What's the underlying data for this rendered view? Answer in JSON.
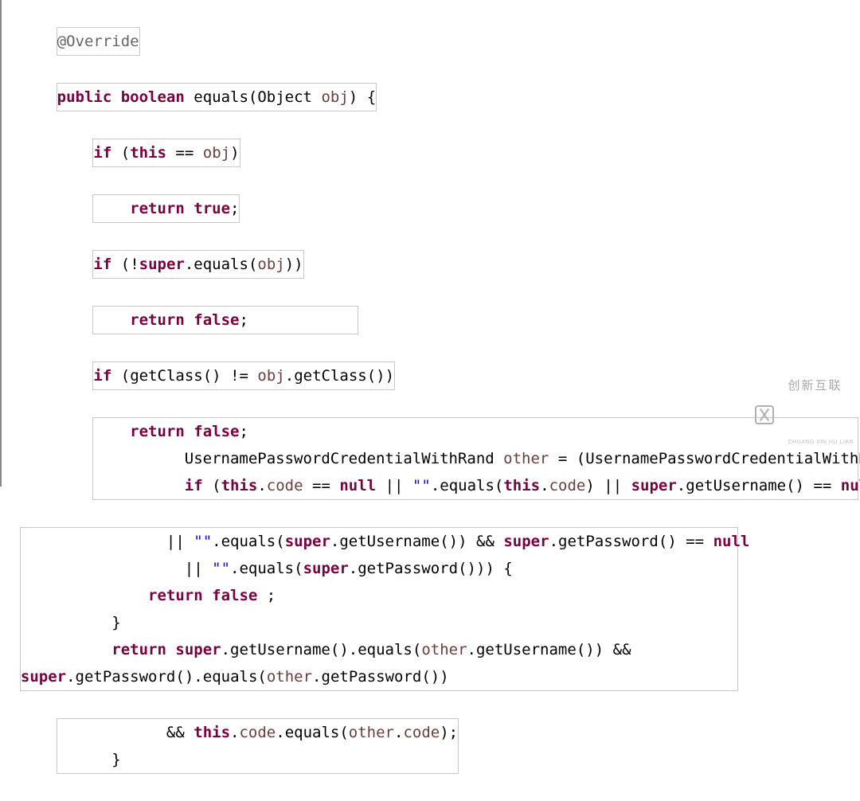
{
  "code": {
    "ann": "@Override",
    "kw_public": "public",
    "kw_boolean": "boolean",
    "m_equals": "equals",
    "t_Object": "Object",
    "p_obj": "obj",
    "kw_if": "if",
    "kw_this": "this",
    "op_eq": "==",
    "kw_return": "return",
    "kw_true": "true",
    "kw_false": "false",
    "kw_super": "super",
    "m_equals2": "equals",
    "m_getClass": "getClass",
    "op_neq": "!=",
    "t_Cred": "UsernamePasswordCredentialWithRand",
    "v_other": "other",
    "op_assign": "=",
    "f_code": "code",
    "kw_null": "null",
    "op_or": "||",
    "str_empty": "\"\"",
    "m_getUsername": "getUsername",
    "m_getPassword": "getPassword",
    "op_and": "&&",
    "semi": ";",
    "dot": ".",
    "comma": ",",
    "lpar": "(",
    "rpar": ")",
    "lbr": "{",
    "rbr": "}",
    "bang": "!",
    "sp": " "
  },
  "watermark": {
    "text": "创新互联",
    "sub": "CHUANG XIN HU LIAN"
  }
}
